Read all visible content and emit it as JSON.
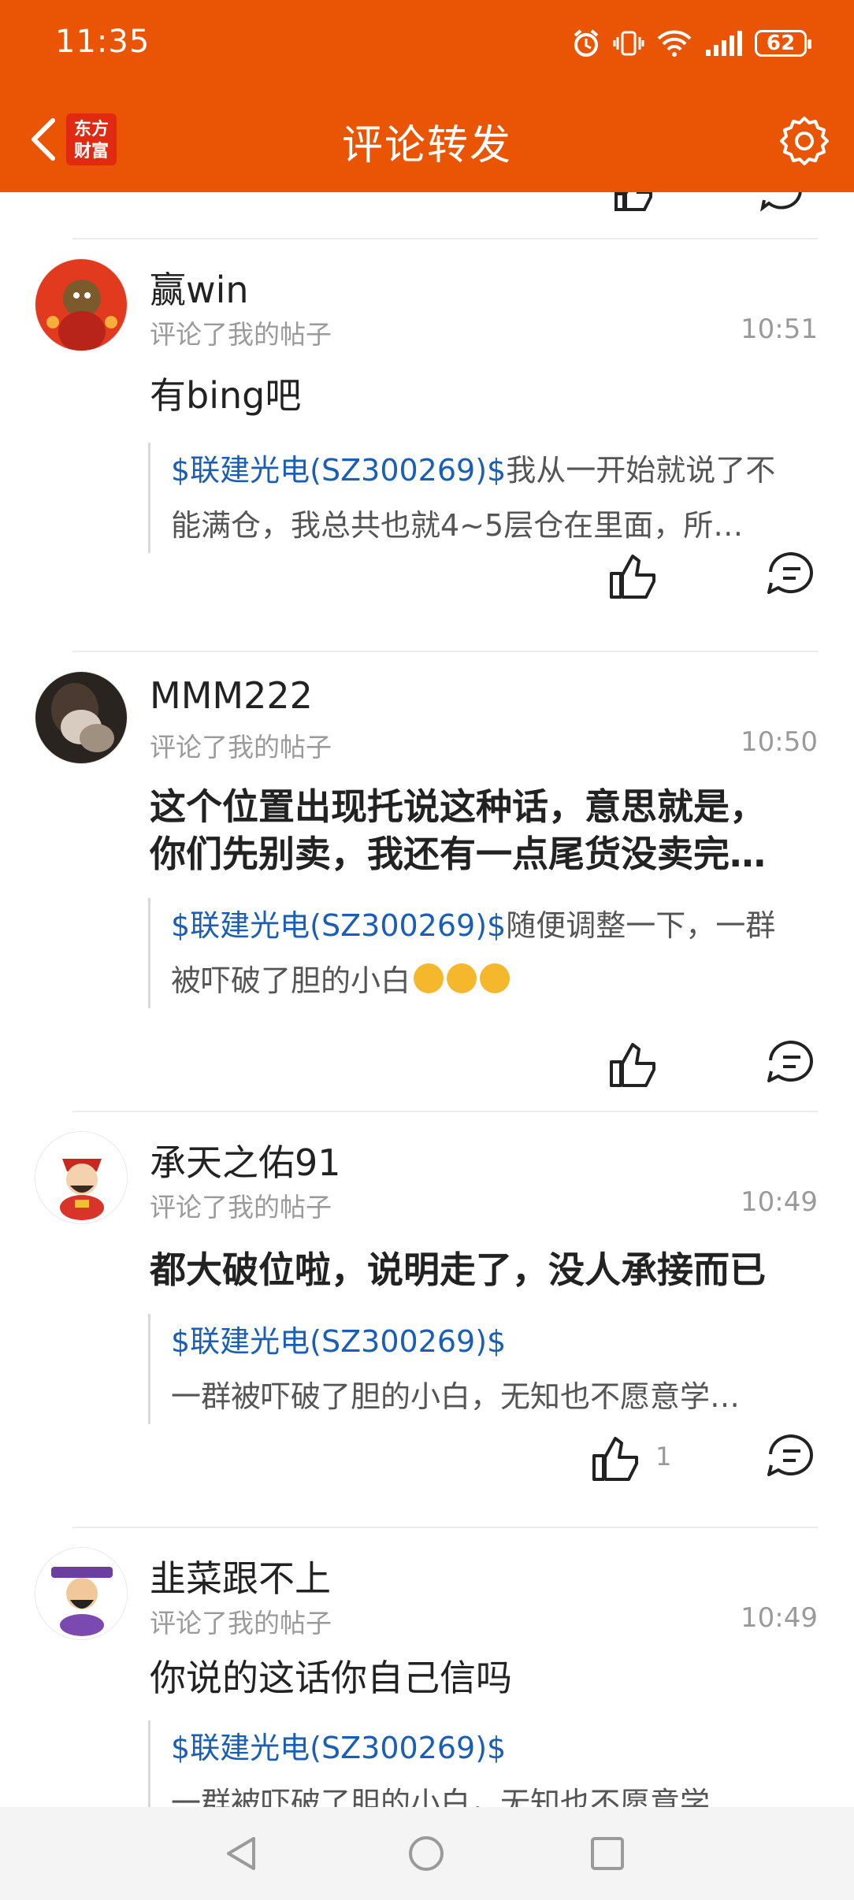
{
  "status_bar": {
    "time": "11:35",
    "battery": "62"
  },
  "header": {
    "title": "评论转发",
    "logo_line1": "东方",
    "logo_line2": "财富"
  },
  "colors": {
    "brand": "#e95504",
    "stock_link": "#1b5fb4"
  },
  "comments": [
    {
      "user": "赢win",
      "action": "评论了我的帖子",
      "time": "10:51",
      "text": "有bing吧",
      "quote_stock": "$联建光电(SZ300269)$",
      "quote_text_1": "我从一开始就说了不",
      "quote_text_2": "能满仓，我总共也就4~5层仓在里面，所…",
      "likes": ""
    },
    {
      "user": "MMM222",
      "action": "评论了我的帖子",
      "time": "10:50",
      "text_1": "这个位置出现托说这种话，意思就是，",
      "text_2": "你们先别卖，我还有一点尾货没卖完…",
      "quote_stock": "$联建光电(SZ300269)$",
      "quote_text_1": "随便调整一下，一群",
      "quote_text_2": "被吓破了胆的小白",
      "likes": ""
    },
    {
      "user": "承天之佑91",
      "action": "评论了我的帖子",
      "time": "10:49",
      "text": "都大破位啦，说明走了，没人承接而已",
      "quote_stock": "$联建光电(SZ300269)$",
      "quote_text_1": "一群被吓破了胆的小白，无知也不愿意学…",
      "likes": "1"
    },
    {
      "user": "韭菜跟不上",
      "action": "评论了我的帖子",
      "time": "10:49",
      "text": "你说的这话你自己信吗",
      "quote_stock": "$联建光电(SZ300269)$",
      "quote_text_1": "一群被吓破了胆的小白，无知也不愿意学…"
    }
  ]
}
